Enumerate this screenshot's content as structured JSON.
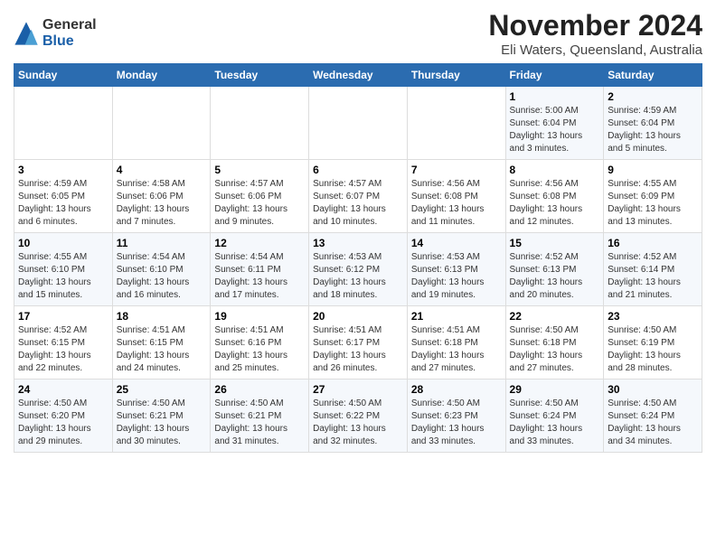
{
  "logo": {
    "general": "General",
    "blue": "Blue"
  },
  "header": {
    "month": "November 2024",
    "location": "Eli Waters, Queensland, Australia"
  },
  "weekdays": [
    "Sunday",
    "Monday",
    "Tuesday",
    "Wednesday",
    "Thursday",
    "Friday",
    "Saturday"
  ],
  "weeks": [
    [
      {
        "day": "",
        "sunrise": "",
        "sunset": "",
        "daylight": ""
      },
      {
        "day": "",
        "sunrise": "",
        "sunset": "",
        "daylight": ""
      },
      {
        "day": "",
        "sunrise": "",
        "sunset": "",
        "daylight": ""
      },
      {
        "day": "",
        "sunrise": "",
        "sunset": "",
        "daylight": ""
      },
      {
        "day": "",
        "sunrise": "",
        "sunset": "",
        "daylight": ""
      },
      {
        "day": "1",
        "sunrise": "Sunrise: 5:00 AM",
        "sunset": "Sunset: 6:04 PM",
        "daylight": "Daylight: 13 hours and 3 minutes."
      },
      {
        "day": "2",
        "sunrise": "Sunrise: 4:59 AM",
        "sunset": "Sunset: 6:04 PM",
        "daylight": "Daylight: 13 hours and 5 minutes."
      }
    ],
    [
      {
        "day": "3",
        "sunrise": "Sunrise: 4:59 AM",
        "sunset": "Sunset: 6:05 PM",
        "daylight": "Daylight: 13 hours and 6 minutes."
      },
      {
        "day": "4",
        "sunrise": "Sunrise: 4:58 AM",
        "sunset": "Sunset: 6:06 PM",
        "daylight": "Daylight: 13 hours and 7 minutes."
      },
      {
        "day": "5",
        "sunrise": "Sunrise: 4:57 AM",
        "sunset": "Sunset: 6:06 PM",
        "daylight": "Daylight: 13 hours and 9 minutes."
      },
      {
        "day": "6",
        "sunrise": "Sunrise: 4:57 AM",
        "sunset": "Sunset: 6:07 PM",
        "daylight": "Daylight: 13 hours and 10 minutes."
      },
      {
        "day": "7",
        "sunrise": "Sunrise: 4:56 AM",
        "sunset": "Sunset: 6:08 PM",
        "daylight": "Daylight: 13 hours and 11 minutes."
      },
      {
        "day": "8",
        "sunrise": "Sunrise: 4:56 AM",
        "sunset": "Sunset: 6:08 PM",
        "daylight": "Daylight: 13 hours and 12 minutes."
      },
      {
        "day": "9",
        "sunrise": "Sunrise: 4:55 AM",
        "sunset": "Sunset: 6:09 PM",
        "daylight": "Daylight: 13 hours and 13 minutes."
      }
    ],
    [
      {
        "day": "10",
        "sunrise": "Sunrise: 4:55 AM",
        "sunset": "Sunset: 6:10 PM",
        "daylight": "Daylight: 13 hours and 15 minutes."
      },
      {
        "day": "11",
        "sunrise": "Sunrise: 4:54 AM",
        "sunset": "Sunset: 6:10 PM",
        "daylight": "Daylight: 13 hours and 16 minutes."
      },
      {
        "day": "12",
        "sunrise": "Sunrise: 4:54 AM",
        "sunset": "Sunset: 6:11 PM",
        "daylight": "Daylight: 13 hours and 17 minutes."
      },
      {
        "day": "13",
        "sunrise": "Sunrise: 4:53 AM",
        "sunset": "Sunset: 6:12 PM",
        "daylight": "Daylight: 13 hours and 18 minutes."
      },
      {
        "day": "14",
        "sunrise": "Sunrise: 4:53 AM",
        "sunset": "Sunset: 6:13 PM",
        "daylight": "Daylight: 13 hours and 19 minutes."
      },
      {
        "day": "15",
        "sunrise": "Sunrise: 4:52 AM",
        "sunset": "Sunset: 6:13 PM",
        "daylight": "Daylight: 13 hours and 20 minutes."
      },
      {
        "day": "16",
        "sunrise": "Sunrise: 4:52 AM",
        "sunset": "Sunset: 6:14 PM",
        "daylight": "Daylight: 13 hours and 21 minutes."
      }
    ],
    [
      {
        "day": "17",
        "sunrise": "Sunrise: 4:52 AM",
        "sunset": "Sunset: 6:15 PM",
        "daylight": "Daylight: 13 hours and 22 minutes."
      },
      {
        "day": "18",
        "sunrise": "Sunrise: 4:51 AM",
        "sunset": "Sunset: 6:15 PM",
        "daylight": "Daylight: 13 hours and 24 minutes."
      },
      {
        "day": "19",
        "sunrise": "Sunrise: 4:51 AM",
        "sunset": "Sunset: 6:16 PM",
        "daylight": "Daylight: 13 hours and 25 minutes."
      },
      {
        "day": "20",
        "sunrise": "Sunrise: 4:51 AM",
        "sunset": "Sunset: 6:17 PM",
        "daylight": "Daylight: 13 hours and 26 minutes."
      },
      {
        "day": "21",
        "sunrise": "Sunrise: 4:51 AM",
        "sunset": "Sunset: 6:18 PM",
        "daylight": "Daylight: 13 hours and 27 minutes."
      },
      {
        "day": "22",
        "sunrise": "Sunrise: 4:50 AM",
        "sunset": "Sunset: 6:18 PM",
        "daylight": "Daylight: 13 hours and 27 minutes."
      },
      {
        "day": "23",
        "sunrise": "Sunrise: 4:50 AM",
        "sunset": "Sunset: 6:19 PM",
        "daylight": "Daylight: 13 hours and 28 minutes."
      }
    ],
    [
      {
        "day": "24",
        "sunrise": "Sunrise: 4:50 AM",
        "sunset": "Sunset: 6:20 PM",
        "daylight": "Daylight: 13 hours and 29 minutes."
      },
      {
        "day": "25",
        "sunrise": "Sunrise: 4:50 AM",
        "sunset": "Sunset: 6:21 PM",
        "daylight": "Daylight: 13 hours and 30 minutes."
      },
      {
        "day": "26",
        "sunrise": "Sunrise: 4:50 AM",
        "sunset": "Sunset: 6:21 PM",
        "daylight": "Daylight: 13 hours and 31 minutes."
      },
      {
        "day": "27",
        "sunrise": "Sunrise: 4:50 AM",
        "sunset": "Sunset: 6:22 PM",
        "daylight": "Daylight: 13 hours and 32 minutes."
      },
      {
        "day": "28",
        "sunrise": "Sunrise: 4:50 AM",
        "sunset": "Sunset: 6:23 PM",
        "daylight": "Daylight: 13 hours and 33 minutes."
      },
      {
        "day": "29",
        "sunrise": "Sunrise: 4:50 AM",
        "sunset": "Sunset: 6:24 PM",
        "daylight": "Daylight: 13 hours and 33 minutes."
      },
      {
        "day": "30",
        "sunrise": "Sunrise: 4:50 AM",
        "sunset": "Sunset: 6:24 PM",
        "daylight": "Daylight: 13 hours and 34 minutes."
      }
    ]
  ]
}
